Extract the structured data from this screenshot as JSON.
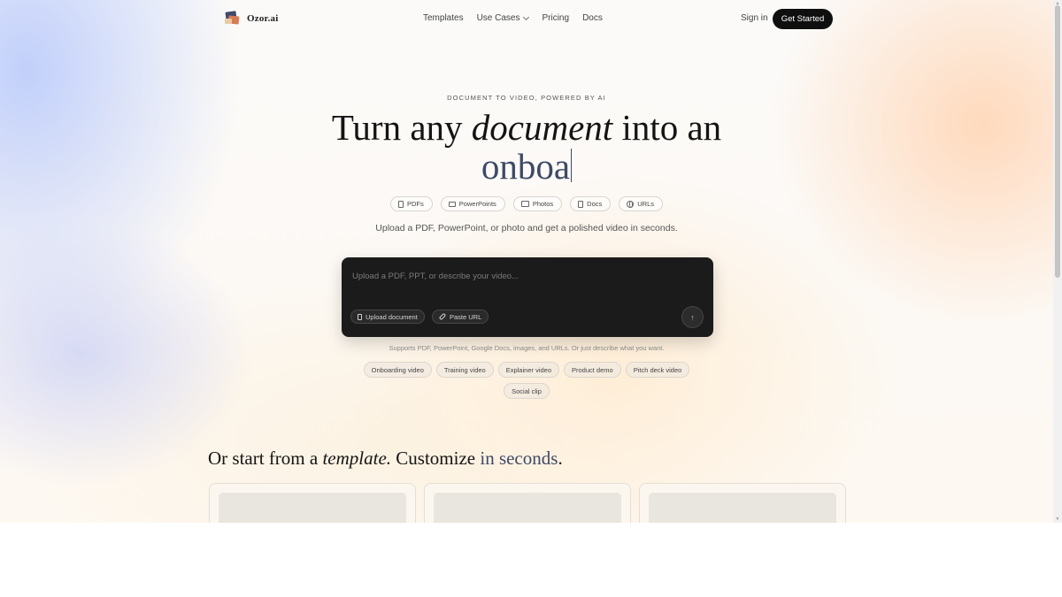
{
  "brand": {
    "name": "Ozor.ai"
  },
  "nav": {
    "links": [
      {
        "label": "Templates"
      },
      {
        "label": "Use Cases"
      },
      {
        "label": "Pricing"
      },
      {
        "label": "Docs"
      }
    ],
    "sign_in": "Sign in",
    "cta": "Get Started"
  },
  "hero": {
    "eyebrow": "DOCUMENT TO VIDEO, POWERED BY AI",
    "headline_start": "Turn any ",
    "headline_emphasis": "document",
    "headline_end": " into an",
    "typing_text": "onboa",
    "subtitle": "Upload a PDF, PowerPoint, or photo and get a polished video in seconds.",
    "formats": [
      {
        "label": "PDFs",
        "icon": "document-icon"
      },
      {
        "label": "PowerPoints",
        "icon": "monitor-icon"
      },
      {
        "label": "Photos",
        "icon": "image-icon"
      },
      {
        "label": "Docs",
        "icon": "document-icon"
      },
      {
        "label": "URLs",
        "icon": "globe-icon"
      }
    ]
  },
  "prompt": {
    "placeholder": "Upload a PDF, PPT, or describe your video...",
    "upload_label": "Upload document",
    "paste_label": "Paste URL",
    "send_icon": "arrow-up-icon",
    "supports_text": "Supports PDF, PowerPoint, Google Docs, images, and URLs. Or just describe what you want."
  },
  "suggestions": [
    "Onboarding video",
    "Training video",
    "Explainer video",
    "Product demo",
    "Pitch deck video",
    "Social clip"
  ],
  "templates_section": {
    "heading_start": "Or start from a ",
    "heading_emphasis": "template.",
    "heading_mid": " Customize ",
    "heading_accent": "in seconds",
    "heading_end": "."
  },
  "colors": {
    "accent": "#3e4a66",
    "cta_background": "#0f0f0f",
    "prompt_background": "#1b1b1b"
  }
}
